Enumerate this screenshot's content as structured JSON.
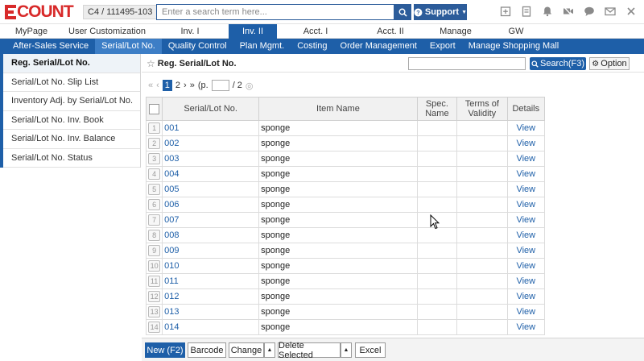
{
  "header": {
    "logo_text": "COUNT",
    "company": "C4 / 111495-103",
    "search_placeholder": "Enter a search term here...",
    "support_label": "Support"
  },
  "main_nav": [
    {
      "label": "MyPage",
      "width": 78
    },
    {
      "label": "User Customization",
      "width": 110
    },
    {
      "label": "Inv. I",
      "width": 96
    },
    {
      "label": "Inv. II",
      "width": 60,
      "active": true
    },
    {
      "label": "Acct. I",
      "width": 96
    },
    {
      "label": "Acct. II",
      "width": 90
    },
    {
      "label": "Manage",
      "width": 72
    },
    {
      "label": "GW",
      "width": 78
    }
  ],
  "sub_nav": [
    {
      "label": "After-Sales Service"
    },
    {
      "label": "Serial/Lot No.",
      "active": true
    },
    {
      "label": "Quality Control"
    },
    {
      "label": "Plan Mgmt."
    },
    {
      "label": "Costing"
    },
    {
      "label": "Order Management"
    },
    {
      "label": "Export"
    },
    {
      "label": "Manage Shopping Mall"
    }
  ],
  "sidebar": {
    "items": [
      {
        "label": "Reg. Serial/Lot No.",
        "active": true
      },
      {
        "label": "Serial/Lot No. Slip List"
      },
      {
        "label": "Inventory Adj. by Serial/Lot No."
      },
      {
        "label": "Serial/Lot No. Inv. Book"
      },
      {
        "label": "Serial/Lot No. Inv. Balance"
      },
      {
        "label": "Serial/Lot No. Status"
      }
    ]
  },
  "content": {
    "title": "Reg. Serial/Lot No.",
    "search_button": "Search(F3)",
    "option_button": "Option"
  },
  "pager": {
    "current": "1",
    "next": "2",
    "prefix": "(p.",
    "total": "/ 2"
  },
  "table": {
    "headers": [
      "Serial/Lot No.",
      "Item Name",
      "Spec. Name",
      "Terms of Validity",
      "Details"
    ],
    "rows": [
      {
        "num": "1",
        "code": "001",
        "item": "sponge",
        "spec": "",
        "validity": "",
        "details": "View"
      },
      {
        "num": "2",
        "code": "002",
        "item": "sponge",
        "spec": "",
        "validity": "",
        "details": "View"
      },
      {
        "num": "3",
        "code": "003",
        "item": "sponge",
        "spec": "",
        "validity": "",
        "details": "View"
      },
      {
        "num": "4",
        "code": "004",
        "item": "sponge",
        "spec": "",
        "validity": "",
        "details": "View"
      },
      {
        "num": "5",
        "code": "005",
        "item": "sponge",
        "spec": "",
        "validity": "",
        "details": "View"
      },
      {
        "num": "6",
        "code": "006",
        "item": "sponge",
        "spec": "",
        "validity": "",
        "details": "View"
      },
      {
        "num": "7",
        "code": "007",
        "item": "sponge",
        "spec": "",
        "validity": "",
        "details": "View"
      },
      {
        "num": "8",
        "code": "008",
        "item": "sponge",
        "spec": "",
        "validity": "",
        "details": "View"
      },
      {
        "num": "9",
        "code": "009",
        "item": "sponge",
        "spec": "",
        "validity": "",
        "details": "View"
      },
      {
        "num": "10",
        "code": "010",
        "item": "sponge",
        "spec": "",
        "validity": "",
        "details": "View"
      },
      {
        "num": "11",
        "code": "011",
        "item": "sponge",
        "spec": "",
        "validity": "",
        "details": "View"
      },
      {
        "num": "12",
        "code": "012",
        "item": "sponge",
        "spec": "",
        "validity": "",
        "details": "View"
      },
      {
        "num": "13",
        "code": "013",
        "item": "sponge",
        "spec": "",
        "validity": "",
        "details": "View"
      },
      {
        "num": "14",
        "code": "014",
        "item": "sponge",
        "spec": "",
        "validity": "",
        "details": "View"
      }
    ]
  },
  "bottom": {
    "new": "New (F2)",
    "barcode": "Barcode",
    "change": "Change",
    "delete_selected": "Delete Selected",
    "excel": "Excel"
  },
  "colors": {
    "brand_red": "#d82a2a",
    "nav_blue": "#1e5fa8",
    "link_blue": "#1e5fa8"
  }
}
